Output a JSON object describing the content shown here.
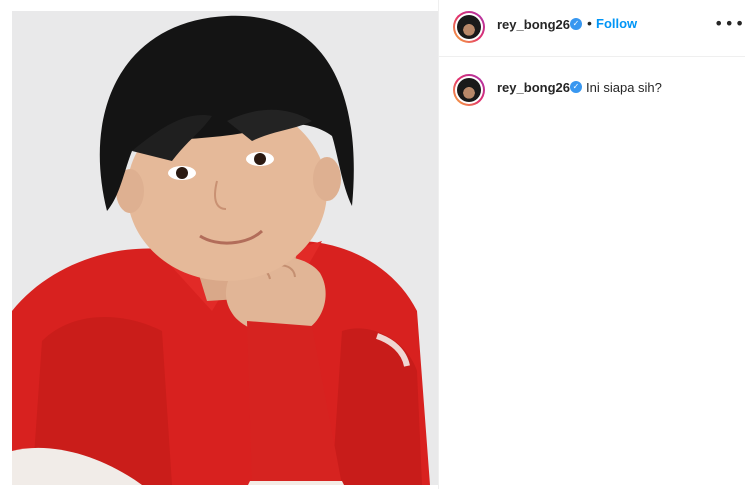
{
  "post": {
    "username": "rey_bong26",
    "follow_label": "Follow",
    "separator": "•",
    "more_label": "•••",
    "verified_glyph": "✓"
  },
  "comment": {
    "username": "rey_bong26",
    "text": "Ini siapa sih?"
  },
  "colors": {
    "accent": "#0095f6",
    "verified": "#3897f0",
    "shirt": "#d8211f"
  },
  "icons": [
    "verified-badge-icon",
    "more-options-icon"
  ]
}
